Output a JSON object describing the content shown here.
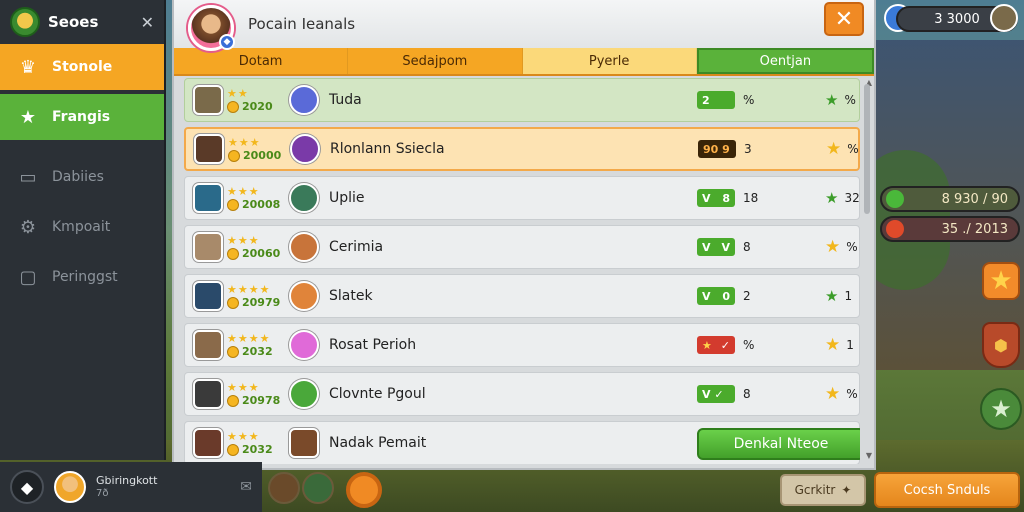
{
  "sidebar": {
    "title": "Seoes",
    "items": [
      {
        "label": "Stonole",
        "icon": "crown-icon"
      },
      {
        "label": "Frangis",
        "icon": "star-icon"
      },
      {
        "label": "Dabiies",
        "icon": "bucket-icon"
      },
      {
        "label": "Kmpoait",
        "icon": "gear-icon"
      },
      {
        "label": "Peringgst",
        "icon": "note-icon"
      }
    ]
  },
  "panel": {
    "title": "Pocain Ieanals",
    "close": "✕",
    "tabs": [
      "Dotam",
      "Sedajpom",
      "Pyerle",
      "Oentjan"
    ]
  },
  "rows": [
    {
      "name": "Tuda",
      "score": "2020",
      "stat1": "2",
      "stat1b": "%",
      "stat2": "%"
    },
    {
      "name": "Rlonlann Ssiecla",
      "score": "20000",
      "stat1": "90 9",
      "stat1b": "3",
      "stat2": "%"
    },
    {
      "name": "Uplie",
      "score": "20008",
      "stat1": "8",
      "stat1b": "18",
      "stat2": "32"
    },
    {
      "name": "Cerimia",
      "score": "20060",
      "stat1": "V",
      "stat1b": "8",
      "stat2": "%"
    },
    {
      "name": "Slatek",
      "score": "20979",
      "stat1": "0",
      "stat1b": "2",
      "stat2": "1"
    },
    {
      "name": "Rosat Perioh",
      "score": "2032",
      "stat1": "",
      "stat1b": "%",
      "stat2": "1"
    },
    {
      "name": "Clovnte Pgoul",
      "score": "20978",
      "stat1": "",
      "stat1b": "8",
      "stat2": "%"
    },
    {
      "name": "Nadak Pemait",
      "score": "2032"
    }
  ],
  "action_button": "Denkal Nteoe",
  "hud": {
    "top_counter": "3 3000",
    "mid_counter": "8 930 / 90",
    "mid_counter2": "35 ./ 2013"
  },
  "bottom": {
    "player_name": "Gbiringkott",
    "player_sub": "7ð",
    "gray_button": "Gcrkitr",
    "orange_button": "Cocsh Snduls"
  }
}
